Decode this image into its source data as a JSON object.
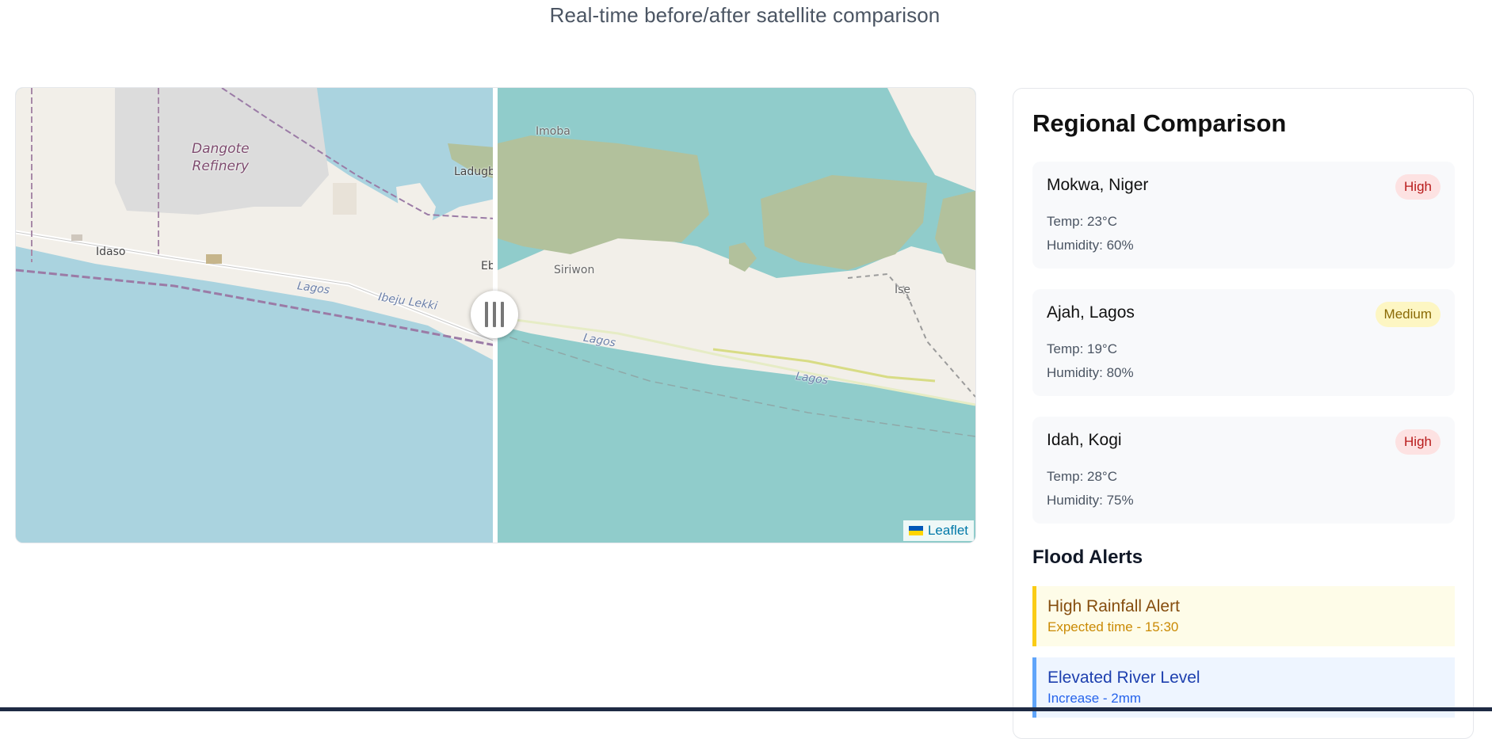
{
  "header": {
    "subtitle": "Real-time before/after satellite comparison"
  },
  "map": {
    "labels": {
      "refinery": "Dangote\nRefinery",
      "idaso": "Idaso",
      "lagos_left": "Lagos",
      "ibeju": "Ibeju Lekki",
      "ladugb": "Ladugb",
      "eb": "Eb",
      "imoba": "Imoba",
      "siriwon": "Siriwon",
      "ise": "Ise",
      "lagos_right1": "Lagos",
      "lagos_right2": "Lagos"
    },
    "attribution": "Leaflet",
    "colors": {
      "water_left": "#aad3df",
      "water_right": "#90cccb",
      "land": "#f2efe9",
      "wetland": "#b2c19c"
    }
  },
  "panel": {
    "title": "Regional Comparison",
    "regions": [
      {
        "name": "Mokwa, Niger",
        "level": "High",
        "temp": "Temp: 23°C",
        "humidity": "Humidity: 60%"
      },
      {
        "name": "Ajah, Lagos",
        "level": "Medium",
        "temp": "Temp: 19°C",
        "humidity": "Humidity: 80%"
      },
      {
        "name": "Idah, Kogi",
        "level": "High",
        "temp": "Temp: 28°C",
        "humidity": "Humidity: 75%"
      }
    ],
    "alerts_title": "Flood Alerts",
    "alerts": [
      {
        "title": "High Rainfall Alert",
        "detail": "Expected time - 15:30",
        "color": "#facc15"
      },
      {
        "title": "Elevated River Level",
        "detail": "Increase - 2mm",
        "color": "#60a5fa"
      }
    ]
  }
}
